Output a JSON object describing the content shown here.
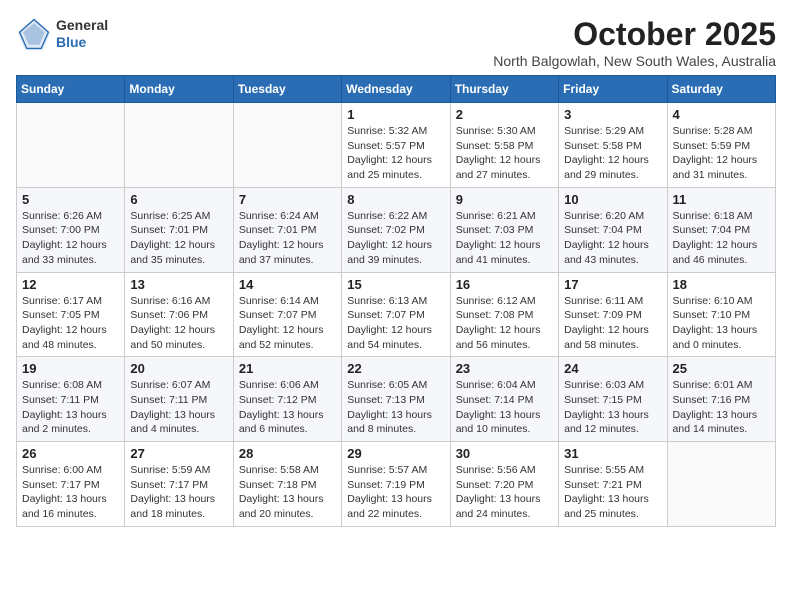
{
  "logo": {
    "general": "General",
    "blue": "Blue"
  },
  "header": {
    "month_title": "October 2025",
    "subtitle": "North Balgowlah, New South Wales, Australia"
  },
  "weekdays": [
    "Sunday",
    "Monday",
    "Tuesday",
    "Wednesday",
    "Thursday",
    "Friday",
    "Saturday"
  ],
  "weeks": [
    [
      {
        "day": "",
        "info": ""
      },
      {
        "day": "",
        "info": ""
      },
      {
        "day": "",
        "info": ""
      },
      {
        "day": "1",
        "info": "Sunrise: 5:32 AM\nSunset: 5:57 PM\nDaylight: 12 hours\nand 25 minutes."
      },
      {
        "day": "2",
        "info": "Sunrise: 5:30 AM\nSunset: 5:58 PM\nDaylight: 12 hours\nand 27 minutes."
      },
      {
        "day": "3",
        "info": "Sunrise: 5:29 AM\nSunset: 5:58 PM\nDaylight: 12 hours\nand 29 minutes."
      },
      {
        "day": "4",
        "info": "Sunrise: 5:28 AM\nSunset: 5:59 PM\nDaylight: 12 hours\nand 31 minutes."
      }
    ],
    [
      {
        "day": "5",
        "info": "Sunrise: 6:26 AM\nSunset: 7:00 PM\nDaylight: 12 hours\nand 33 minutes."
      },
      {
        "day": "6",
        "info": "Sunrise: 6:25 AM\nSunset: 7:01 PM\nDaylight: 12 hours\nand 35 minutes."
      },
      {
        "day": "7",
        "info": "Sunrise: 6:24 AM\nSunset: 7:01 PM\nDaylight: 12 hours\nand 37 minutes."
      },
      {
        "day": "8",
        "info": "Sunrise: 6:22 AM\nSunset: 7:02 PM\nDaylight: 12 hours\nand 39 minutes."
      },
      {
        "day": "9",
        "info": "Sunrise: 6:21 AM\nSunset: 7:03 PM\nDaylight: 12 hours\nand 41 minutes."
      },
      {
        "day": "10",
        "info": "Sunrise: 6:20 AM\nSunset: 7:04 PM\nDaylight: 12 hours\nand 43 minutes."
      },
      {
        "day": "11",
        "info": "Sunrise: 6:18 AM\nSunset: 7:04 PM\nDaylight: 12 hours\nand 46 minutes."
      }
    ],
    [
      {
        "day": "12",
        "info": "Sunrise: 6:17 AM\nSunset: 7:05 PM\nDaylight: 12 hours\nand 48 minutes."
      },
      {
        "day": "13",
        "info": "Sunrise: 6:16 AM\nSunset: 7:06 PM\nDaylight: 12 hours\nand 50 minutes."
      },
      {
        "day": "14",
        "info": "Sunrise: 6:14 AM\nSunset: 7:07 PM\nDaylight: 12 hours\nand 52 minutes."
      },
      {
        "day": "15",
        "info": "Sunrise: 6:13 AM\nSunset: 7:07 PM\nDaylight: 12 hours\nand 54 minutes."
      },
      {
        "day": "16",
        "info": "Sunrise: 6:12 AM\nSunset: 7:08 PM\nDaylight: 12 hours\nand 56 minutes."
      },
      {
        "day": "17",
        "info": "Sunrise: 6:11 AM\nSunset: 7:09 PM\nDaylight: 12 hours\nand 58 minutes."
      },
      {
        "day": "18",
        "info": "Sunrise: 6:10 AM\nSunset: 7:10 PM\nDaylight: 13 hours\nand 0 minutes."
      }
    ],
    [
      {
        "day": "19",
        "info": "Sunrise: 6:08 AM\nSunset: 7:11 PM\nDaylight: 13 hours\nand 2 minutes."
      },
      {
        "day": "20",
        "info": "Sunrise: 6:07 AM\nSunset: 7:11 PM\nDaylight: 13 hours\nand 4 minutes."
      },
      {
        "day": "21",
        "info": "Sunrise: 6:06 AM\nSunset: 7:12 PM\nDaylight: 13 hours\nand 6 minutes."
      },
      {
        "day": "22",
        "info": "Sunrise: 6:05 AM\nSunset: 7:13 PM\nDaylight: 13 hours\nand 8 minutes."
      },
      {
        "day": "23",
        "info": "Sunrise: 6:04 AM\nSunset: 7:14 PM\nDaylight: 13 hours\nand 10 minutes."
      },
      {
        "day": "24",
        "info": "Sunrise: 6:03 AM\nSunset: 7:15 PM\nDaylight: 13 hours\nand 12 minutes."
      },
      {
        "day": "25",
        "info": "Sunrise: 6:01 AM\nSunset: 7:16 PM\nDaylight: 13 hours\nand 14 minutes."
      }
    ],
    [
      {
        "day": "26",
        "info": "Sunrise: 6:00 AM\nSunset: 7:17 PM\nDaylight: 13 hours\nand 16 minutes."
      },
      {
        "day": "27",
        "info": "Sunrise: 5:59 AM\nSunset: 7:17 PM\nDaylight: 13 hours\nand 18 minutes."
      },
      {
        "day": "28",
        "info": "Sunrise: 5:58 AM\nSunset: 7:18 PM\nDaylight: 13 hours\nand 20 minutes."
      },
      {
        "day": "29",
        "info": "Sunrise: 5:57 AM\nSunset: 7:19 PM\nDaylight: 13 hours\nand 22 minutes."
      },
      {
        "day": "30",
        "info": "Sunrise: 5:56 AM\nSunset: 7:20 PM\nDaylight: 13 hours\nand 24 minutes."
      },
      {
        "day": "31",
        "info": "Sunrise: 5:55 AM\nSunset: 7:21 PM\nDaylight: 13 hours\nand 25 minutes."
      },
      {
        "day": "",
        "info": ""
      }
    ]
  ]
}
